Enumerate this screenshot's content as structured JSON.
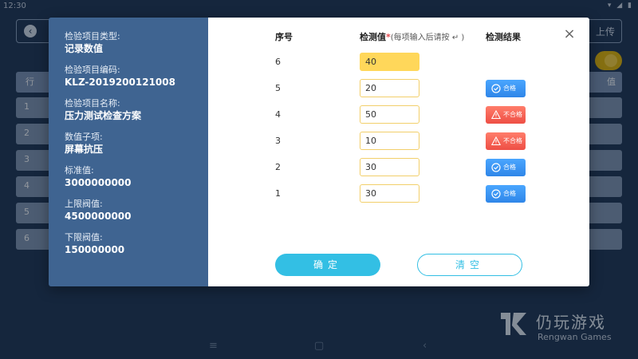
{
  "statusbar": {
    "time": "12:30"
  },
  "background": {
    "upload_label": "上传",
    "column_left": "行",
    "column_right": "值",
    "row_chars": [
      "1",
      "2",
      "3",
      "4",
      "5",
      "6"
    ]
  },
  "dialog": {
    "info": [
      {
        "label": "检验项目类型:",
        "value": "记录数值"
      },
      {
        "label": "检验项目编码:",
        "value": "KLZ-2019200121008"
      },
      {
        "label": "检验项目名称:",
        "value": "压力测试检查方案"
      },
      {
        "label": "数值子项:",
        "value": "屏幕抗压"
      },
      {
        "label": "标准值:",
        "value": "3000000000"
      },
      {
        "label": "上限阀值:",
        "value": "4500000000"
      },
      {
        "label": "下限阀值:",
        "value": "150000000"
      }
    ],
    "table": {
      "header_no": "序号",
      "header_value": "检测值",
      "header_required": "*",
      "header_hint": "(每项输入后请按 ↵ )",
      "header_result": "检测结果"
    },
    "rows": [
      {
        "no": "6",
        "value": "40",
        "result": ""
      },
      {
        "no": "5",
        "value": "20",
        "result": "合格"
      },
      {
        "no": "4",
        "value": "50",
        "result": "不合格"
      },
      {
        "no": "3",
        "value": "10",
        "result": "不合格"
      },
      {
        "no": "2",
        "value": "30",
        "result": "合格"
      },
      {
        "no": "1",
        "value": "30",
        "result": "合格"
      }
    ],
    "buttons": {
      "confirm": "确定",
      "clear": "清空"
    },
    "colors": {
      "pass": "#2f86e8",
      "fail": "#ee4f45",
      "primary": "#33bfe4",
      "active_input": "#ffd75a",
      "panel": "#3f6491"
    }
  },
  "watermark": {
    "cn": "仍玩游戏",
    "en": "Rengwan Games"
  }
}
